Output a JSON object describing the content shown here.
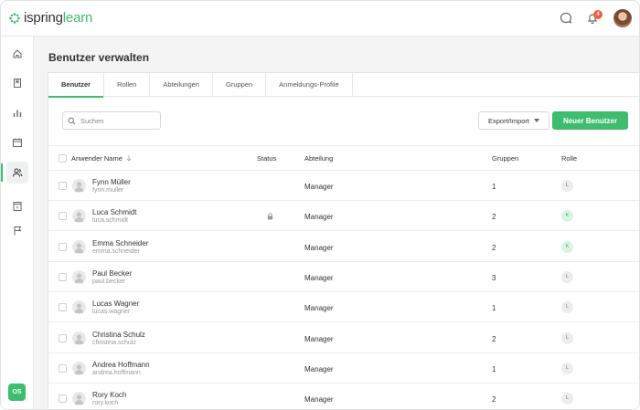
{
  "app": {
    "logo_primary": "ispring",
    "logo_secondary": "learn",
    "notifications_count": "4",
    "org_initials": "OS",
    "accent_color": "#3dbd6d"
  },
  "page": {
    "title": "Benutzer verwalten"
  },
  "tabs": [
    {
      "label": "Benutzer",
      "active": true
    },
    {
      "label": "Rollen"
    },
    {
      "label": "Abteilungen"
    },
    {
      "label": "Gruppen"
    },
    {
      "label": "Anmeldungs-Profile"
    }
  ],
  "toolbar": {
    "search_placeholder": "Suchen",
    "export_label": "Export/Import",
    "new_user_label": "Neuer Benutzer"
  },
  "table": {
    "columns": {
      "username": "Anwender Name",
      "status": "Status",
      "department": "Abteilung",
      "groups": "Gruppen",
      "role": "Rolle"
    },
    "rows": [
      {
        "name": "Fynn Müller",
        "login": "fynn.muller",
        "locked": false,
        "department": "Manager",
        "groups": "1",
        "role": "L"
      },
      {
        "name": "Luca Schmidt",
        "login": "luca.schmidt",
        "locked": true,
        "department": "Manager",
        "groups": "2",
        "role": "K"
      },
      {
        "name": "Emma Schneider",
        "login": "emma.schneider",
        "locked": false,
        "department": "Manager",
        "groups": "2",
        "role": "K"
      },
      {
        "name": "Paul Becker",
        "login": "paul.becker",
        "locked": false,
        "department": "Manager",
        "groups": "3",
        "role": "L"
      },
      {
        "name": "Lucas Wagner",
        "login": "lucas.wagner",
        "locked": false,
        "department": "Manager",
        "groups": "1",
        "role": "L"
      },
      {
        "name": "Christina Schulz",
        "login": "christina.schulz",
        "locked": false,
        "department": "Manager",
        "groups": "2",
        "role": "L"
      },
      {
        "name": "Andrea Hoffmann",
        "login": "andrea.hoffmann",
        "locked": false,
        "department": "Manager",
        "groups": "1",
        "role": "L"
      },
      {
        "name": "Rory Koch",
        "login": "rory.koch",
        "locked": false,
        "department": "Manager",
        "groups": "2",
        "role": "L"
      }
    ]
  }
}
